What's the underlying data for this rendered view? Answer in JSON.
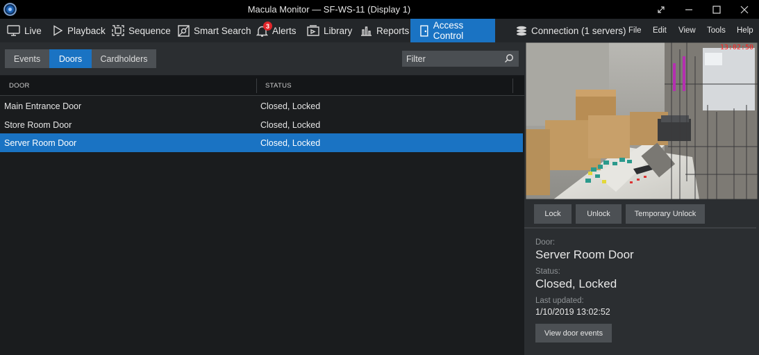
{
  "window": {
    "title": "Macula Monitor — SF-WS-11 (Display 1)"
  },
  "nav": {
    "items": [
      {
        "label": "Live",
        "icon": "monitor-icon"
      },
      {
        "label": "Playback",
        "icon": "play-icon"
      },
      {
        "label": "Sequence",
        "icon": "grid-icon"
      },
      {
        "label": "Smart Search",
        "icon": "smart-search-icon"
      },
      {
        "label": "Alerts",
        "icon": "bell-icon",
        "badge": "3"
      },
      {
        "label": "Library",
        "icon": "library-icon"
      },
      {
        "label": "Reports",
        "icon": "chart-icon"
      },
      {
        "label": "Access Control",
        "icon": "door-icon",
        "active": true
      }
    ],
    "connection": "Connection (1 servers)",
    "menus": [
      "File",
      "Edit",
      "View",
      "Tools",
      "Help"
    ]
  },
  "tabs": [
    {
      "label": "Events",
      "active": false
    },
    {
      "label": "Doors",
      "active": true
    },
    {
      "label": "Cardholders",
      "active": false
    }
  ],
  "filter": {
    "placeholder": "Filter"
  },
  "table": {
    "columns": [
      "DOOR",
      "STATUS"
    ],
    "rows": [
      {
        "door": "Main Entrance Door",
        "status": "Closed, Locked",
        "selected": false
      },
      {
        "door": "Store Room Door",
        "status": "Closed, Locked",
        "selected": false
      },
      {
        "door": "Server Room Door",
        "status": "Closed, Locked",
        "selected": true
      }
    ]
  },
  "camera": {
    "timestamp": "13:02:50"
  },
  "actions": {
    "lock": "Lock",
    "unlock": "Unlock",
    "temporary_unlock": "Temporary Unlock"
  },
  "details": {
    "door_label": "Door:",
    "door_value": "Server Room Door",
    "status_label": "Status:",
    "status_value": "Closed, Locked",
    "updated_label": "Last updated:",
    "updated_value": "1/10/2019 13:02:52",
    "view_events": "View door events"
  },
  "colors": {
    "accent": "#1a73c3",
    "badge": "#e0262b",
    "panel": "#2b2e31",
    "background": "#1a1c1e"
  }
}
